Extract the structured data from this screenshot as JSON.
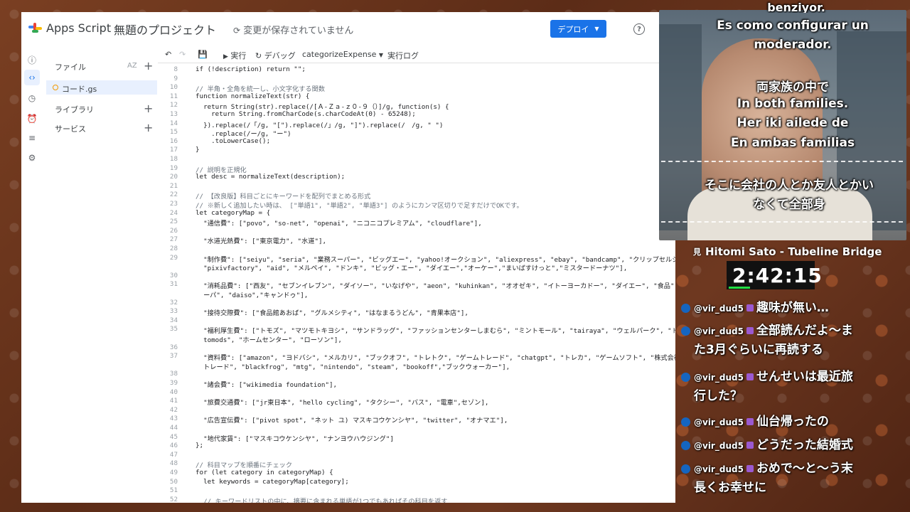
{
  "app": {
    "brand": "Apps Script",
    "project_name": "無題のプロジェクト",
    "save_status": "変更が保存されていません",
    "deploy_label": "デプロイ",
    "help_label": "?"
  },
  "files_panel": {
    "files_label": "ファイル",
    "sort_label": "AZ",
    "file_name": "コード.gs",
    "libraries_label": "ライブラリ",
    "services_label": "サービス"
  },
  "toolbar": {
    "run_label": "実行",
    "debug_label": "デバッグ",
    "function_name": "categorizeExpense",
    "log_label": "実行ログ"
  },
  "code_lines": [
    {
      "n": "8",
      "t": "if (!description) return \"\";"
    },
    {
      "n": "9",
      "t": ""
    },
    {
      "n": "10",
      "t": "// 半角・全角を統一し、小文字化する関数"
    },
    {
      "n": "11",
      "t": "function normalizeText(str) {"
    },
    {
      "n": "12",
      "t": "  return String(str).replace(/[Ａ-Ｚａ-ｚ０-９（）]/g, function(s) {"
    },
    {
      "n": "13",
      "t": "    return String.fromCharCode(s.charCodeAt(0) - 65248);"
    },
    {
      "n": "14",
      "t": "  }).replace(/「/g, \"[\").replace(/」/g, \"]\").replace(/　/g, \" \")"
    },
    {
      "n": "15",
      "t": "    .replace(/ー/g, \"ー\")"
    },
    {
      "n": "16",
      "t": "    .toLowerCase();"
    },
    {
      "n": "17",
      "t": "}"
    },
    {
      "n": "18",
      "t": ""
    },
    {
      "n": "19",
      "t": "// 説明を正規化"
    },
    {
      "n": "20",
      "t": "let desc = normalizeText(description);"
    },
    {
      "n": "21",
      "t": ""
    },
    {
      "n": "22",
      "t": "// 【改良版】科目ごとにキーワードを配列でまとめる形式"
    },
    {
      "n": "23",
      "t": "// ※新しく追加したい時は、 [\"単語1\", \"単語2\", \"単語3\"] のようにカンマ区切りで足すだけでOKです。"
    },
    {
      "n": "24",
      "t": "let categoryMap = {"
    },
    {
      "n": "25",
      "t": "  \"通信費\": [\"povo\", \"so-net\", \"openai\", \"ニコニコプレミアム\", \"cloudflare\"],"
    },
    {
      "n": "26",
      "t": ""
    },
    {
      "n": "27",
      "t": "  \"水道光熱費\": [\"東京電力\", \"水道\"],"
    },
    {
      "n": "28",
      "t": ""
    },
    {
      "n": "29",
      "t": "  \"制作費\": [\"seiyu\", \"seria\", \"業務スーパー\", \"ビッグエー\", \"yahoo!オークション\", \"aliexpress\", \"ebay\", \"bandcamp\", \"クリップセルシス\","
    },
    {
      "n": "",
      "t": "  \"pixivfactory\", \"aid\", \"メルペイ\", \"ドンキ\", \"ビッグ・エー\", \"ダイエー\",\"オーケー\",\"まいばすけっと\",\"ミスタードーナツ\"],"
    },
    {
      "n": "30",
      "t": ""
    },
    {
      "n": "31",
      "t": "  \"消耗品費\": [\"西友\", \"セブンイレブン\", \"ダイソー\", \"いなげや\", \"aeon\", \"kuhinkan\", \"オオゼキ\", \"イトーヨーカドー\", \"ダイエー\", \"食品\", \"業務ス"
    },
    {
      "n": "",
      "t": "  ーパ\", \"daiso\",\"キャンドゥ\"],"
    },
    {
      "n": "32",
      "t": ""
    },
    {
      "n": "33",
      "t": "  \"接待交際費\": [\"食品館あおば\", \"グルメシティ\", \"はなまるうどん\", \"青果本店\"],"
    },
    {
      "n": "34",
      "t": ""
    },
    {
      "n": "35",
      "t": "  \"福利厚生費\": [\"トモズ\", \"マツモトキヨシ\", \"サンドラッグ\", \"ファッションセンターしまむら\", \"ミントモール\", \"tairaya\", \"ウェルパーク\", \"トップ"
    },
    {
      "n": "",
      "t": "  tomods\", \"ホームセンター\", \"ローソン\"],"
    },
    {
      "n": "36",
      "t": ""
    },
    {
      "n": "37",
      "t": "  \"資料費\": [\"amazon\", \"ヨドバシ\", \"メルカリ\", \"ブックオフ\", \"トレトク\", \"ゲームトレード\", \"chatgpt\", \"トレカ\", \"ゲームソフト\", \"株式会社ゲーム"
    },
    {
      "n": "",
      "t": "  トレード\", \"blackfrog\", \"mtg\", \"nintendo\", \"steam\", \"bookoff\",\"ブックウォーカー\"],"
    },
    {
      "n": "38",
      "t": ""
    },
    {
      "n": "39",
      "t": "  \"諸会費\": [\"wikimedia foundation\"],"
    },
    {
      "n": "40",
      "t": ""
    },
    {
      "n": "41",
      "t": "  \"旅費交通費\": [\"jr東日本\", \"hello cycling\", \"タクシー\", \"バス\", \"電車\",セゾン],"
    },
    {
      "n": "42",
      "t": ""
    },
    {
      "n": "43",
      "t": "  \"広告宣伝費\": [\"pivot spot\", \"ネット ユ) マスキコウケンシヤ\", \"twitter\", \"オナマエ\"],"
    },
    {
      "n": "44",
      "t": ""
    },
    {
      "n": "45",
      "t": "  \"地代家賃\": [\"マスキコウケンシヤ\", \"ナンヨウハウジング\"]"
    },
    {
      "n": "46",
      "t": "};"
    },
    {
      "n": "47",
      "t": ""
    },
    {
      "n": "48",
      "t": "// 科目マップを順番にチェック"
    },
    {
      "n": "49",
      "t": "for (let category in categoryMap) {"
    },
    {
      "n": "50",
      "t": "  let keywords = categoryMap[category];"
    },
    {
      "n": "51",
      "t": ""
    },
    {
      "n": "52",
      "t": "  // キーワードリストの中に、摘要に含まれる単語が1つでもあればその科目を返す"
    }
  ],
  "subtitles": {
    "top_partial": "benziyor.",
    "es1": "Es como configurar un",
    "es2": "moderador.",
    "ja1": "両家族の中で",
    "en1": "In both families.",
    "tr1": "Her iki ailede de",
    "es3": "En ambas familias",
    "ja2": "そこに会社の人とか友人とかい",
    "ja3": "なくて全部身"
  },
  "stream": {
    "title": "Hitomi Sato - Tubeline Bridge",
    "title_prefix": "見",
    "timer": "2:42:15"
  },
  "chat": [
    {
      "user": "@vir_dud5",
      "text": "趣味が無い…",
      "cont": ""
    },
    {
      "user": "@vir_dud5",
      "text": "全部読んだよ～ま",
      "cont": "た3月ぐらいに再読する"
    },
    {
      "user": "@vir_dud5",
      "text": "せんせいは最近旅",
      "cont": "行した？"
    },
    {
      "user": "@vir_dud5",
      "text": "仙台帰ったの",
      "cont": ""
    },
    {
      "user": "@vir_dud5",
      "text": "どうだった結婚式",
      "cont": ""
    },
    {
      "user": "@vir_dud5",
      "text": "おめで～と～う末",
      "cont": "長くお幸せに"
    }
  ],
  "colors": {
    "accent": "#1a73e8",
    "timer_bar": "#22dd44",
    "chat_bullet": "#1565c0"
  }
}
